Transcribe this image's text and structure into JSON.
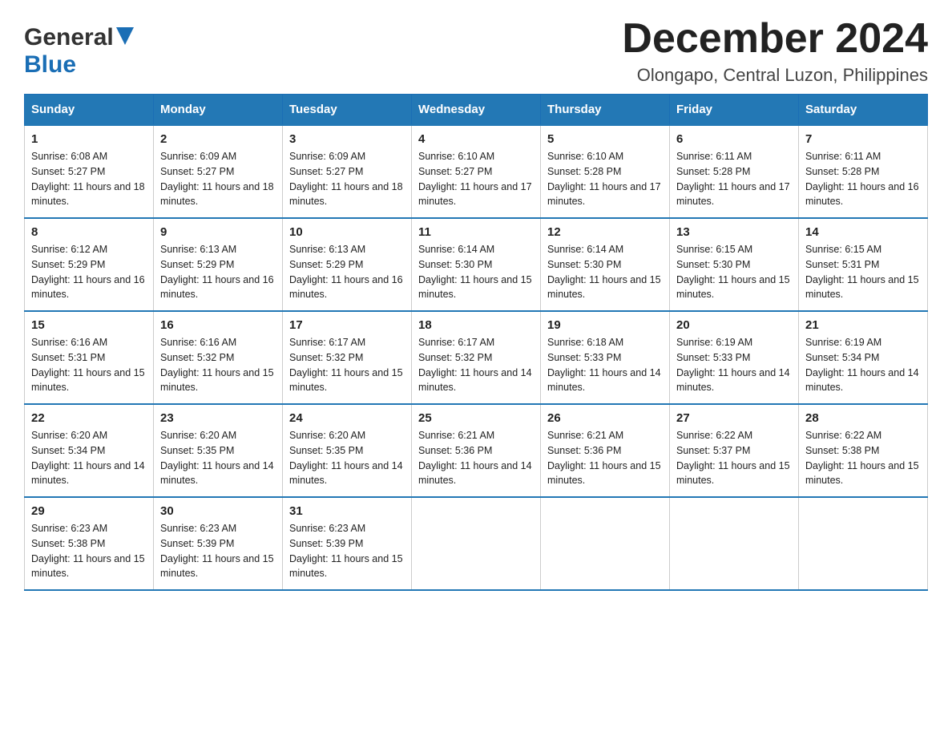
{
  "header": {
    "logo_general": "General",
    "logo_blue": "Blue",
    "month_title": "December 2024",
    "location": "Olongapo, Central Luzon, Philippines"
  },
  "days_of_week": [
    "Sunday",
    "Monday",
    "Tuesday",
    "Wednesday",
    "Thursday",
    "Friday",
    "Saturday"
  ],
  "weeks": [
    [
      {
        "day": "1",
        "sunrise": "6:08 AM",
        "sunset": "5:27 PM",
        "daylight": "11 hours and 18 minutes."
      },
      {
        "day": "2",
        "sunrise": "6:09 AM",
        "sunset": "5:27 PM",
        "daylight": "11 hours and 18 minutes."
      },
      {
        "day": "3",
        "sunrise": "6:09 AM",
        "sunset": "5:27 PM",
        "daylight": "11 hours and 18 minutes."
      },
      {
        "day": "4",
        "sunrise": "6:10 AM",
        "sunset": "5:27 PM",
        "daylight": "11 hours and 17 minutes."
      },
      {
        "day": "5",
        "sunrise": "6:10 AM",
        "sunset": "5:28 PM",
        "daylight": "11 hours and 17 minutes."
      },
      {
        "day": "6",
        "sunrise": "6:11 AM",
        "sunset": "5:28 PM",
        "daylight": "11 hours and 17 minutes."
      },
      {
        "day": "7",
        "sunrise": "6:11 AM",
        "sunset": "5:28 PM",
        "daylight": "11 hours and 16 minutes."
      }
    ],
    [
      {
        "day": "8",
        "sunrise": "6:12 AM",
        "sunset": "5:29 PM",
        "daylight": "11 hours and 16 minutes."
      },
      {
        "day": "9",
        "sunrise": "6:13 AM",
        "sunset": "5:29 PM",
        "daylight": "11 hours and 16 minutes."
      },
      {
        "day": "10",
        "sunrise": "6:13 AM",
        "sunset": "5:29 PM",
        "daylight": "11 hours and 16 minutes."
      },
      {
        "day": "11",
        "sunrise": "6:14 AM",
        "sunset": "5:30 PM",
        "daylight": "11 hours and 15 minutes."
      },
      {
        "day": "12",
        "sunrise": "6:14 AM",
        "sunset": "5:30 PM",
        "daylight": "11 hours and 15 minutes."
      },
      {
        "day": "13",
        "sunrise": "6:15 AM",
        "sunset": "5:30 PM",
        "daylight": "11 hours and 15 minutes."
      },
      {
        "day": "14",
        "sunrise": "6:15 AM",
        "sunset": "5:31 PM",
        "daylight": "11 hours and 15 minutes."
      }
    ],
    [
      {
        "day": "15",
        "sunrise": "6:16 AM",
        "sunset": "5:31 PM",
        "daylight": "11 hours and 15 minutes."
      },
      {
        "day": "16",
        "sunrise": "6:16 AM",
        "sunset": "5:32 PM",
        "daylight": "11 hours and 15 minutes."
      },
      {
        "day": "17",
        "sunrise": "6:17 AM",
        "sunset": "5:32 PM",
        "daylight": "11 hours and 15 minutes."
      },
      {
        "day": "18",
        "sunrise": "6:17 AM",
        "sunset": "5:32 PM",
        "daylight": "11 hours and 14 minutes."
      },
      {
        "day": "19",
        "sunrise": "6:18 AM",
        "sunset": "5:33 PM",
        "daylight": "11 hours and 14 minutes."
      },
      {
        "day": "20",
        "sunrise": "6:19 AM",
        "sunset": "5:33 PM",
        "daylight": "11 hours and 14 minutes."
      },
      {
        "day": "21",
        "sunrise": "6:19 AM",
        "sunset": "5:34 PM",
        "daylight": "11 hours and 14 minutes."
      }
    ],
    [
      {
        "day": "22",
        "sunrise": "6:20 AM",
        "sunset": "5:34 PM",
        "daylight": "11 hours and 14 minutes."
      },
      {
        "day": "23",
        "sunrise": "6:20 AM",
        "sunset": "5:35 PM",
        "daylight": "11 hours and 14 minutes."
      },
      {
        "day": "24",
        "sunrise": "6:20 AM",
        "sunset": "5:35 PM",
        "daylight": "11 hours and 14 minutes."
      },
      {
        "day": "25",
        "sunrise": "6:21 AM",
        "sunset": "5:36 PM",
        "daylight": "11 hours and 14 minutes."
      },
      {
        "day": "26",
        "sunrise": "6:21 AM",
        "sunset": "5:36 PM",
        "daylight": "11 hours and 15 minutes."
      },
      {
        "day": "27",
        "sunrise": "6:22 AM",
        "sunset": "5:37 PM",
        "daylight": "11 hours and 15 minutes."
      },
      {
        "day": "28",
        "sunrise": "6:22 AM",
        "sunset": "5:38 PM",
        "daylight": "11 hours and 15 minutes."
      }
    ],
    [
      {
        "day": "29",
        "sunrise": "6:23 AM",
        "sunset": "5:38 PM",
        "daylight": "11 hours and 15 minutes."
      },
      {
        "day": "30",
        "sunrise": "6:23 AM",
        "sunset": "5:39 PM",
        "daylight": "11 hours and 15 minutes."
      },
      {
        "day": "31",
        "sunrise": "6:23 AM",
        "sunset": "5:39 PM",
        "daylight": "11 hours and 15 minutes."
      },
      null,
      null,
      null,
      null
    ]
  ],
  "labels": {
    "sunrise": "Sunrise:",
    "sunset": "Sunset:",
    "daylight": "Daylight:"
  }
}
